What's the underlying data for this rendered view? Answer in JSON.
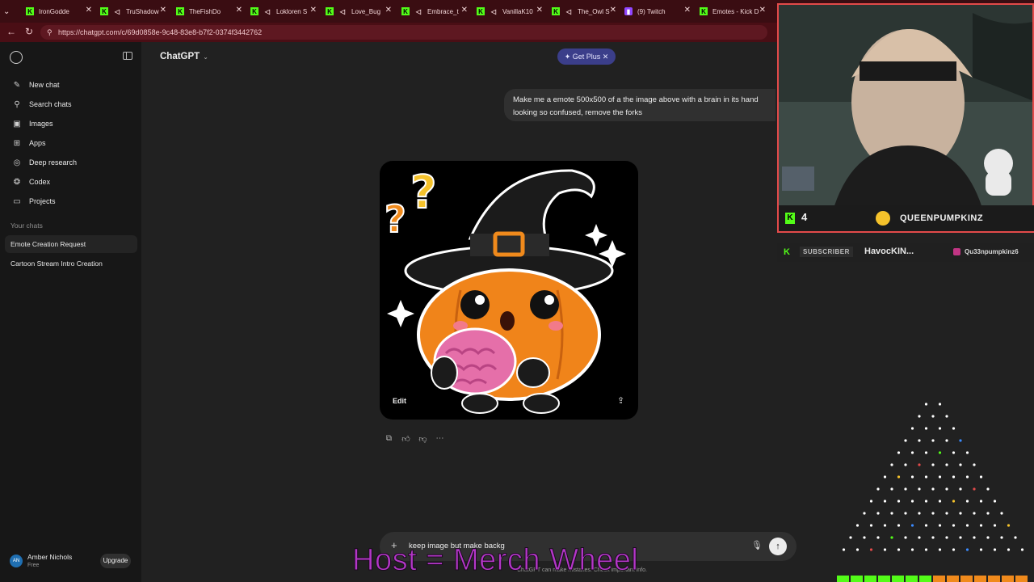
{
  "browser": {
    "tabs": [
      {
        "label": "IronGodde",
        "icon": "kick-icon"
      },
      {
        "label": "TruShadow",
        "icon": "speaker-icon"
      },
      {
        "label": "TheFishDo",
        "icon": "kick-icon"
      },
      {
        "label": "Lokloren S",
        "icon": "speaker-icon"
      },
      {
        "label": "Love_Bug",
        "icon": "kick-icon"
      },
      {
        "label": "Embrace_t",
        "icon": "speaker-icon"
      },
      {
        "label": "VanillaK10",
        "icon": "kick-icon"
      },
      {
        "label": "The_Owl S",
        "icon": "speaker-icon"
      },
      {
        "label": "(9) Twitch",
        "icon": "twitch-icon"
      },
      {
        "label": "Emotes - Kick D",
        "icon": "kick-icon"
      }
    ],
    "url": "https://chatgpt.com/c/69d0858e-9c48-83e8-b7f2-0374f3442762"
  },
  "sidebar": {
    "items": [
      {
        "label": "New chat",
        "icon": "new-chat-icon"
      },
      {
        "label": "Search chats",
        "icon": "search-icon"
      },
      {
        "label": "Images",
        "icon": "images-icon"
      },
      {
        "label": "Apps",
        "icon": "apps-icon"
      },
      {
        "label": "Deep research",
        "icon": "deep-research-icon"
      },
      {
        "label": "Codex",
        "icon": "codex-icon"
      },
      {
        "label": "Projects",
        "icon": "folder-icon"
      }
    ],
    "section_title": "Your chats",
    "chats": [
      {
        "label": "Emote Creation Request",
        "active": true
      },
      {
        "label": "Cartoon Stream Intro Creation",
        "active": false
      }
    ],
    "user": {
      "initials": "AN",
      "name": "Amber Nichols",
      "plan": "Free",
      "upgrade_label": "Upgrade"
    }
  },
  "header": {
    "title": "ChatGPT",
    "get_plus_label": "Get Plus",
    "get_plus_color": "#3b3e8a"
  },
  "conversation": {
    "user_message": "Make me a emote 500x500 of a the image above with a brain in its hand looking so confused, remove the forks",
    "image": {
      "edit_label": "Edit",
      "description_icon": "pumpkin-witch-emote"
    }
  },
  "composer": {
    "value": "keep image but make backg",
    "disclaimer": "ChatGPT can make mistakes. Check important info."
  },
  "stream": {
    "kick_count": "4",
    "streamer_name": "QUEENPUMPKINZ",
    "subscriber_label": "SUBSCRIBER",
    "subscriber_name": "HavocKIN...",
    "social_handle": "Qu33npumpkinz6",
    "overlay_text": "Host = Merch Wheel",
    "accent_color": "#e34a4a",
    "kick_color": "#53fc18"
  }
}
